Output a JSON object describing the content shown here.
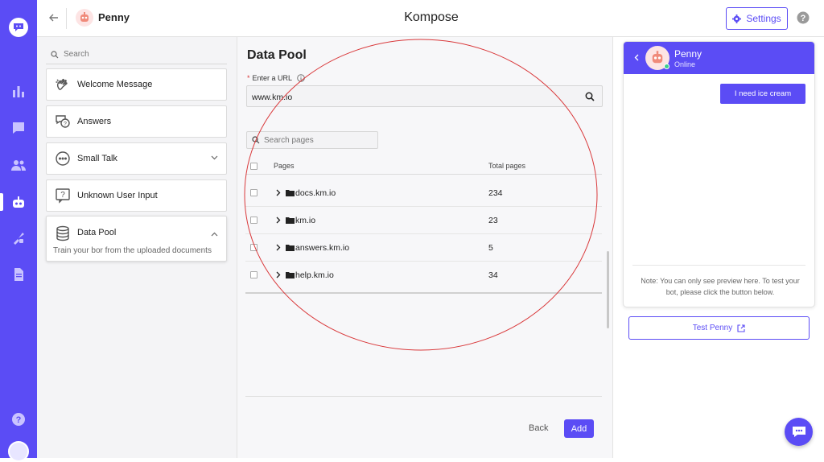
{
  "header": {
    "agent_name": "Penny",
    "app_title": "Kompose",
    "settings_label": "Settings"
  },
  "sidebar": {
    "search_placeholder": "Search",
    "items": [
      {
        "label": "Welcome Message",
        "icon": "wave-icon"
      },
      {
        "label": "Answers",
        "icon": "question-bubble-icon"
      },
      {
        "label": "Small Talk",
        "icon": "chat-dots-icon"
      },
      {
        "label": "Unknown User Input",
        "icon": "question-box-icon"
      },
      {
        "label": "Data Pool",
        "icon": "database-icon",
        "description": "Train your bor from the uploaded documents"
      }
    ]
  },
  "main": {
    "title": "Data Pool",
    "url_label_required": "*",
    "url_label": "Enter a URL",
    "url_value": "www.km.io",
    "search_pages_placeholder": "Search pages",
    "table": {
      "columns": [
        "Pages",
        "Total pages"
      ],
      "rows": [
        {
          "page": "docs.km.io",
          "total": "234"
        },
        {
          "page": "km.io",
          "total": "23"
        },
        {
          "page": "answers.km.io",
          "total": "5"
        },
        {
          "page": "help.km.io",
          "total": "34"
        }
      ]
    },
    "back_label": "Back",
    "add_label": "Add"
  },
  "preview": {
    "bot_name": "Penny",
    "status": "Online",
    "user_message": "I need ice cream",
    "note": "Note: You can only see preview here. To test your bot, please click the button below.",
    "test_button_label": "Test Penny"
  },
  "colors": {
    "accent": "#5b4cf5",
    "annotation_circle": "#d9383a"
  }
}
